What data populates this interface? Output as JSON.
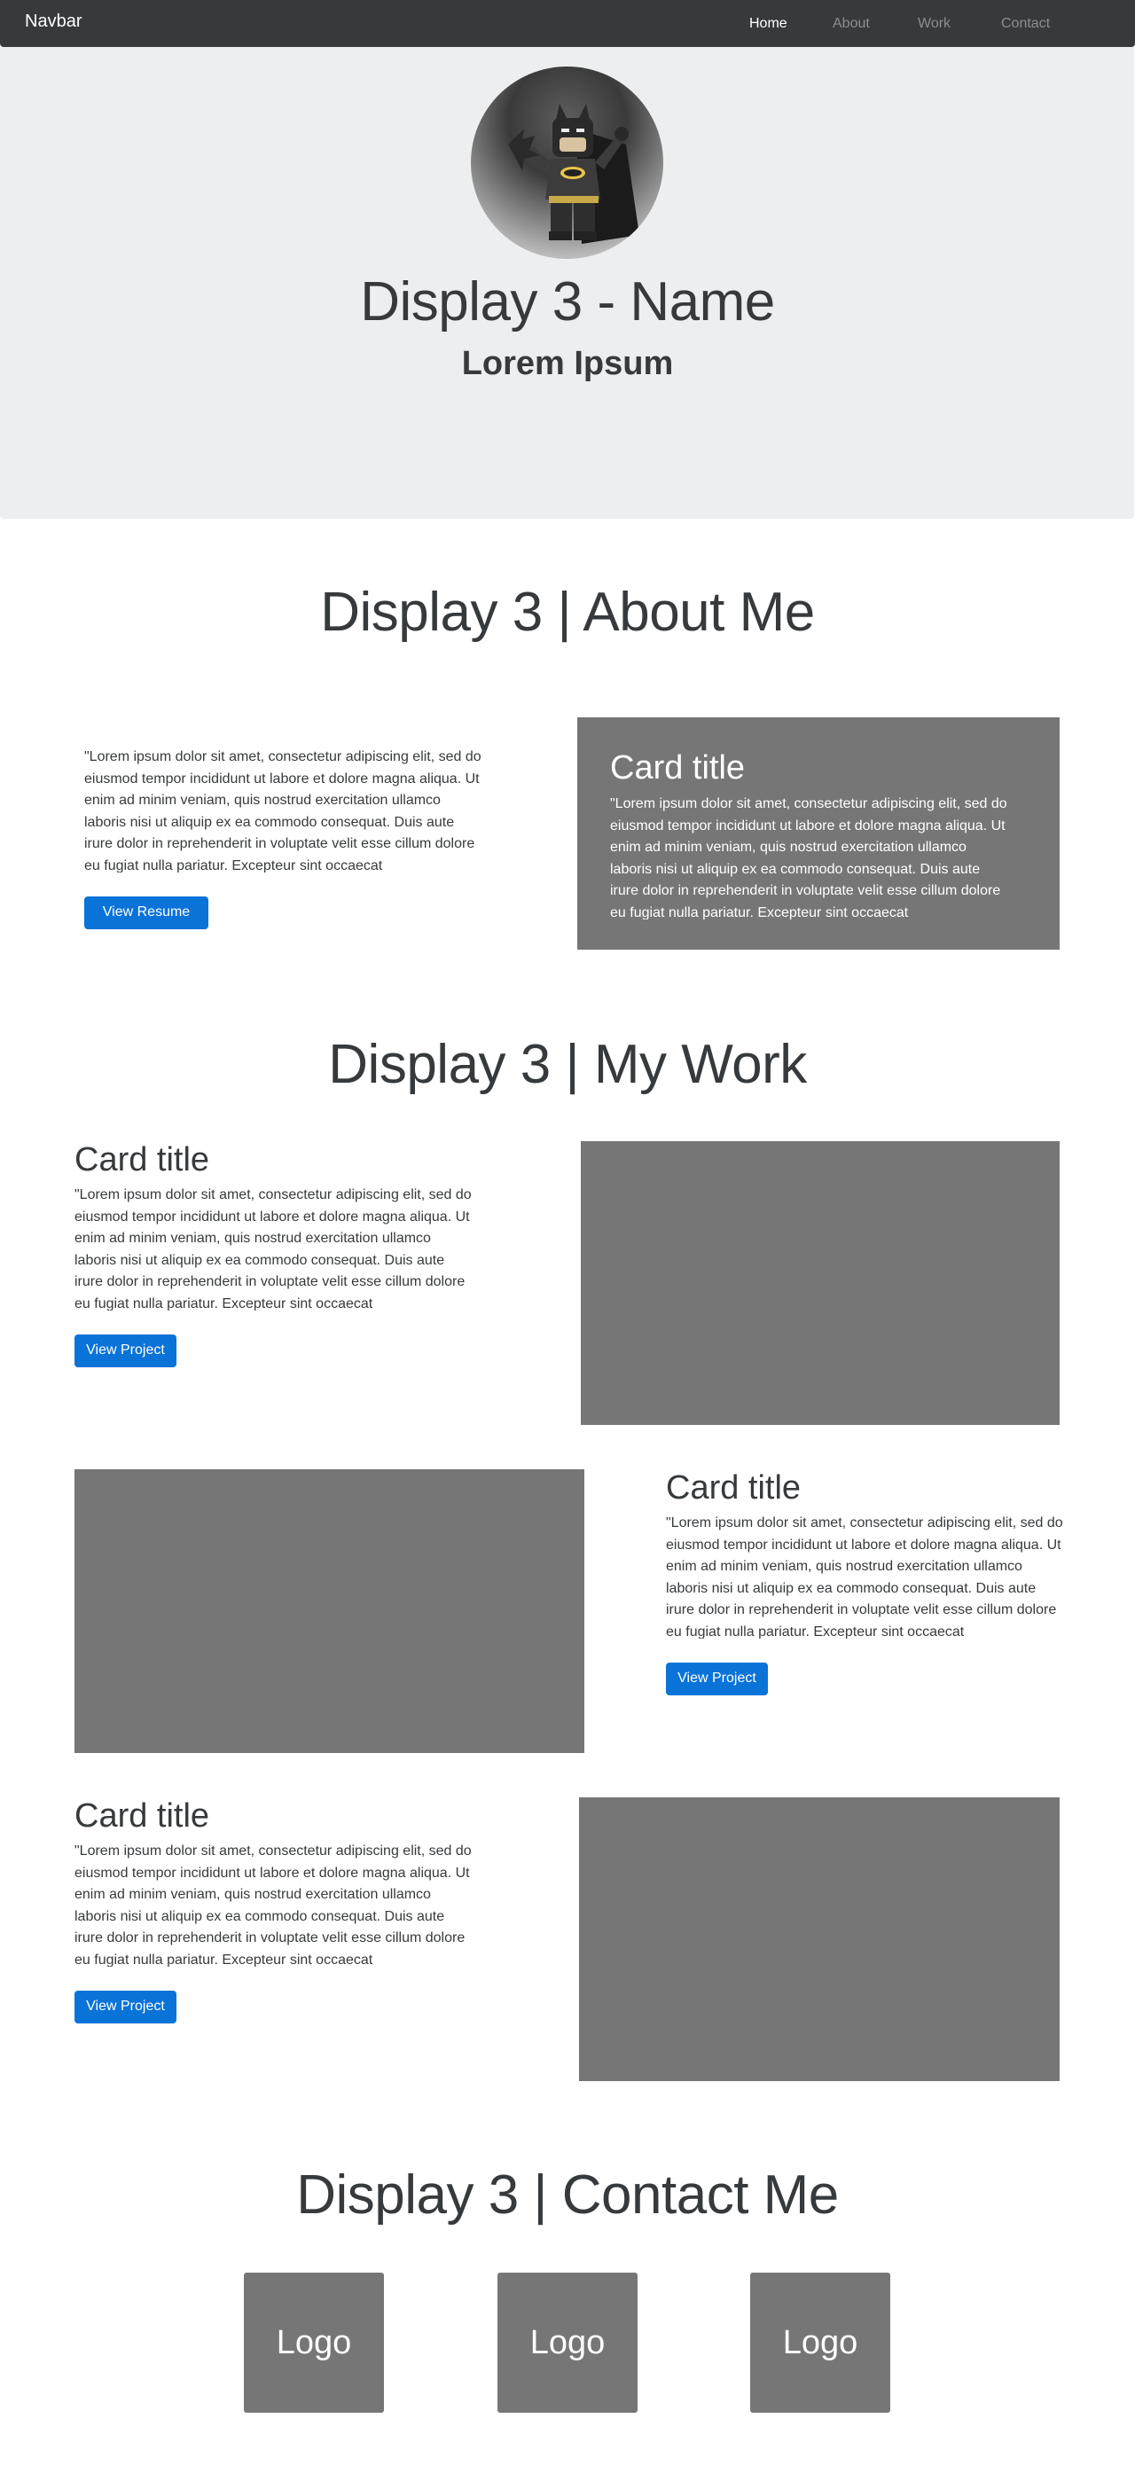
{
  "navbar": {
    "brand": "Navbar",
    "links": [
      {
        "label": "Home",
        "active": true
      },
      {
        "label": "About",
        "active": false
      },
      {
        "label": "Work",
        "active": false
      },
      {
        "label": "Contact",
        "active": false
      }
    ]
  },
  "hero": {
    "name": "Display 3 - Name",
    "subtitle": "Lorem Ipsum",
    "avatar_icon": "lego-batman-avatar"
  },
  "about": {
    "title": "Display 3 | About Me",
    "text": "\"Lorem ipsum dolor sit amet, consectetur adipiscing elit, sed do eiusmod tempor incididunt ut labore et dolore magna aliqua. Ut enim ad minim veniam, quis nostrud exercitation ullamco laboris nisi ut aliquip ex ea commodo consequat. Duis aute irure dolor in reprehenderit in voluptate velit esse cillum dolore eu fugiat nulla pariatur. Excepteur sint occaecat",
    "button": "View Resume",
    "card": {
      "title": "Card title",
      "text": "\"Lorem ipsum dolor sit amet, consectetur adipiscing elit, sed do eiusmod tempor incididunt ut labore et dolore magna aliqua. Ut enim ad minim veniam, quis nostrud exercitation ullamco laboris nisi ut aliquip ex ea commodo consequat. Duis aute irure dolor in reprehenderit in voluptate velit esse cillum dolore eu fugiat nulla pariatur. Excepteur sint occaecat"
    }
  },
  "work": {
    "title": "Display 3 | My Work",
    "projects": [
      {
        "title": "Card title",
        "text": "\"Lorem ipsum dolor sit amet, consectetur adipiscing elit, sed do eiusmod tempor incididunt ut labore et dolore magna aliqua. Ut enim ad minim veniam, quis nostrud exercitation ullamco laboris nisi ut aliquip ex ea commodo consequat. Duis aute irure dolor in reprehenderit in voluptate velit esse cillum dolore eu fugiat nulla pariatur. Excepteur sint occaecat",
        "button": "View Project"
      },
      {
        "title": "Card title",
        "text": "\"Lorem ipsum dolor sit amet, consectetur adipiscing elit, sed do eiusmod tempor incididunt ut labore et dolore magna aliqua. Ut enim ad minim veniam, quis nostrud exercitation ullamco laboris nisi ut aliquip ex ea commodo consequat. Duis aute irure dolor in reprehenderit in voluptate velit esse cillum dolore eu fugiat nulla pariatur. Excepteur sint occaecat",
        "button": "View Project"
      },
      {
        "title": "Card title",
        "text": "\"Lorem ipsum dolor sit amet, consectetur adipiscing elit, sed do eiusmod tempor incididunt ut labore et dolore magna aliqua. Ut enim ad minim veniam, quis nostrud exercitation ullamco laboris nisi ut aliquip ex ea commodo consequat. Duis aute irure dolor in reprehenderit in voluptate velit esse cillum dolore eu fugiat nulla pariatur. Excepteur sint occaecat",
        "button": "View Project"
      }
    ]
  },
  "contact": {
    "title": "Display 3 | Contact Me",
    "logos": [
      "Logo",
      "Logo",
      "Logo"
    ]
  },
  "colors": {
    "navbar_bg": "#373a3c",
    "hero_bg": "#eceeef",
    "button_primary": "#0a73d8",
    "placeholder_gray": "#767676"
  }
}
